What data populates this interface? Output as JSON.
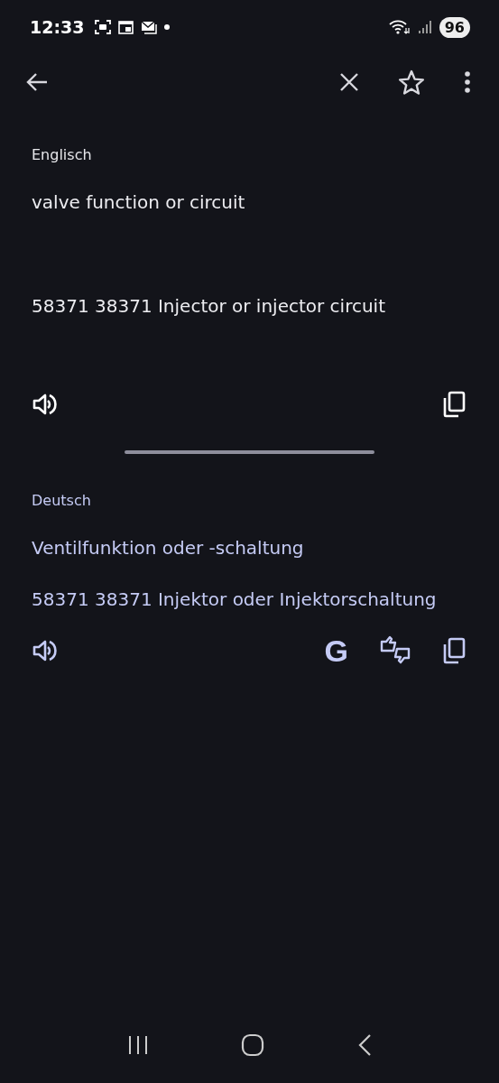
{
  "status_bar": {
    "time": "12:33",
    "battery": "96"
  },
  "source": {
    "language": "Englisch",
    "lines": [
      "valve function or circuit",
      "58371 38371 Injector or injector circuit"
    ]
  },
  "target": {
    "language": "Deutsch",
    "lines": [
      "Ventilfunktion oder -schaltung",
      "58371 38371 Injektor oder Injektorschaltung"
    ],
    "search_glyph": "G"
  }
}
